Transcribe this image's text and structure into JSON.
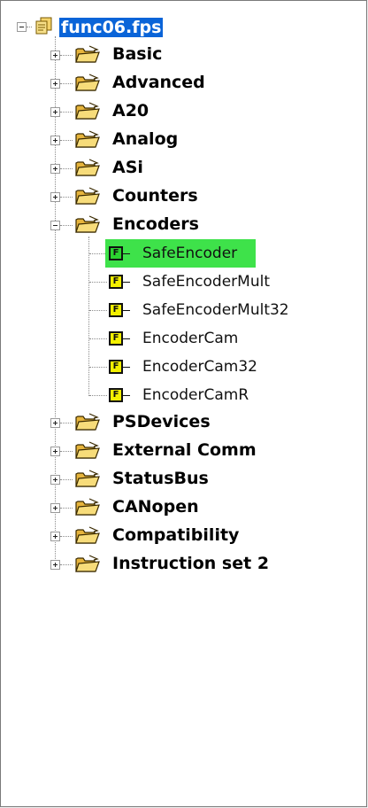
{
  "tree": {
    "root": {
      "label": "func06.fps"
    },
    "folders": [
      {
        "id": "basic",
        "label": "Basic"
      },
      {
        "id": "advanced",
        "label": "Advanced"
      },
      {
        "id": "a20",
        "label": "A20"
      },
      {
        "id": "analog",
        "label": "Analog"
      },
      {
        "id": "asi",
        "label": "ASi"
      },
      {
        "id": "counters",
        "label": "Counters"
      },
      {
        "id": "encoders",
        "label": "Encoders"
      },
      {
        "id": "psdevices",
        "label": "PSDevices"
      },
      {
        "id": "external-comm",
        "label": "External Comm"
      },
      {
        "id": "statusbus",
        "label": "StatusBus"
      },
      {
        "id": "canopen",
        "label": "CANopen"
      },
      {
        "id": "compatibility",
        "label": "Compatibility"
      },
      {
        "id": "instruction-set-2",
        "label": "Instruction set 2"
      }
    ],
    "encoder_items": [
      {
        "label": "SafeEncoder",
        "badge": "F",
        "selected": true
      },
      {
        "label": "SafeEncoderMult",
        "badge": "F",
        "selected": false
      },
      {
        "label": "SafeEncoderMult32",
        "badge": "F",
        "selected": false
      },
      {
        "label": "EncoderCam",
        "badge": "F",
        "selected": false
      },
      {
        "label": "EncoderCam32",
        "badge": "F",
        "selected": false
      },
      {
        "label": "EncoderCamR",
        "badge": "F",
        "selected": false
      }
    ],
    "colors": {
      "root_highlight": "#0a64d8",
      "selected_highlight": "#3ee24a",
      "function_badge": "#f3f000",
      "folder": "#f2c94c"
    }
  }
}
